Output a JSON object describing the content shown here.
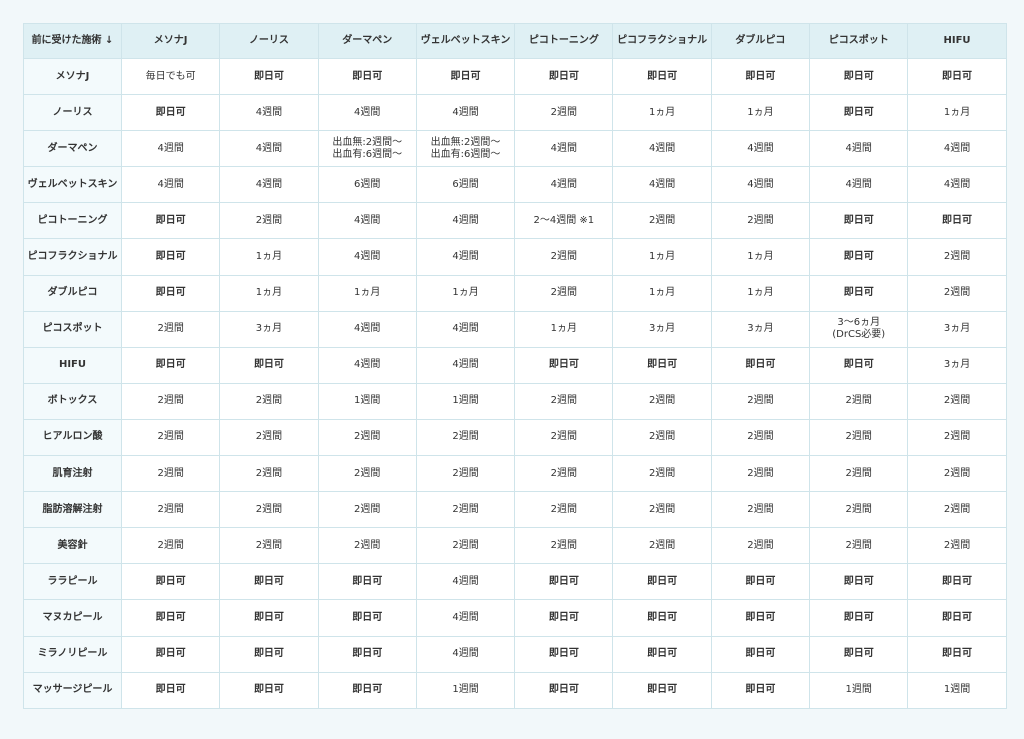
{
  "table": {
    "corner": "前に受けた施術 ↓",
    "columns": [
      "メソナJ",
      "ノーリス",
      "ダーマペン",
      "ヴェルベットスキン",
      "ピコトーニング",
      "ピコフラクショナル",
      "ダブルピコ",
      "ピコスポット",
      "HIFU"
    ],
    "rows": [
      {
        "label": "メソナJ",
        "cells": [
          "毎日でも可",
          "即日可",
          "即日可",
          "即日可",
          "即日可",
          "即日可",
          "即日可",
          "即日可",
          "即日可"
        ]
      },
      {
        "label": "ノーリス",
        "cells": [
          "即日可",
          "4週間",
          "4週間",
          "4週間",
          "2週間",
          "1ヵ月",
          "1ヵ月",
          "即日可",
          "1ヵ月"
        ]
      },
      {
        "label": "ダーマペン",
        "cells": [
          "4週間",
          "4週間",
          "出血無:2週間〜\n出血有:6週間〜",
          "出血無:2週間〜\n出血有:6週間〜",
          "4週間",
          "4週間",
          "4週間",
          "4週間",
          "4週間"
        ]
      },
      {
        "label": "ヴェルベットスキン",
        "cells": [
          "4週間",
          "4週間",
          "6週間",
          "6週間",
          "4週間",
          "4週間",
          "4週間",
          "4週間",
          "4週間"
        ]
      },
      {
        "label": "ピコトーニング",
        "cells": [
          "即日可",
          "2週間",
          "4週間",
          "4週間",
          "2〜4週間 ※1",
          "2週間",
          "2週間",
          "即日可",
          "即日可"
        ]
      },
      {
        "label": "ピコフラクショナル",
        "cells": [
          "即日可",
          "1ヵ月",
          "4週間",
          "4週間",
          "2週間",
          "1ヵ月",
          "1ヵ月",
          "即日可",
          "2週間"
        ]
      },
      {
        "label": "ダブルピコ",
        "cells": [
          "即日可",
          "1ヵ月",
          "1ヵ月",
          "1ヵ月",
          "2週間",
          "1ヵ月",
          "1ヵ月",
          "即日可",
          "2週間"
        ]
      },
      {
        "label": "ピコスポット",
        "cells": [
          "2週間",
          "3ヵ月",
          "4週間",
          "4週間",
          "1ヵ月",
          "3ヵ月",
          "3ヵ月",
          "3〜6ヵ月\n(DrCS必要)",
          "3ヵ月"
        ]
      },
      {
        "label": "HIFU",
        "cells": [
          "即日可",
          "即日可",
          "4週間",
          "4週間",
          "即日可",
          "即日可",
          "即日可",
          "即日可",
          "3ヵ月"
        ]
      },
      {
        "label": "ボトックス",
        "cells": [
          "2週間",
          "2週間",
          "1週間",
          "1週間",
          "2週間",
          "2週間",
          "2週間",
          "2週間",
          "2週間"
        ]
      },
      {
        "label": "ヒアルロン酸",
        "cells": [
          "2週間",
          "2週間",
          "2週間",
          "2週間",
          "2週間",
          "2週間",
          "2週間",
          "2週間",
          "2週間"
        ]
      },
      {
        "label": "肌育注射",
        "cells": [
          "2週間",
          "2週間",
          "2週間",
          "2週間",
          "2週間",
          "2週間",
          "2週間",
          "2週間",
          "2週間"
        ]
      },
      {
        "label": "脂肪溶解注射",
        "cells": [
          "2週間",
          "2週間",
          "2週間",
          "2週間",
          "2週間",
          "2週間",
          "2週間",
          "2週間",
          "2週間"
        ]
      },
      {
        "label": "美容針",
        "cells": [
          "2週間",
          "2週間",
          "2週間",
          "2週間",
          "2週間",
          "2週間",
          "2週間",
          "2週間",
          "2週間"
        ]
      },
      {
        "label": "ララピール",
        "cells": [
          "即日可",
          "即日可",
          "即日可",
          "4週間",
          "即日可",
          "即日可",
          "即日可",
          "即日可",
          "即日可"
        ]
      },
      {
        "label": "マヌカピール",
        "cells": [
          "即日可",
          "即日可",
          "即日可",
          "4週間",
          "即日可",
          "即日可",
          "即日可",
          "即日可",
          "即日可"
        ]
      },
      {
        "label": "ミラノリピール",
        "cells": [
          "即日可",
          "即日可",
          "即日可",
          "4週間",
          "即日可",
          "即日可",
          "即日可",
          "即日可",
          "即日可"
        ]
      },
      {
        "label": "マッサージピール",
        "cells": [
          "即日可",
          "即日可",
          "即日可",
          "1週間",
          "即日可",
          "即日可",
          "即日可",
          "1週間",
          "1週間"
        ]
      }
    ]
  }
}
